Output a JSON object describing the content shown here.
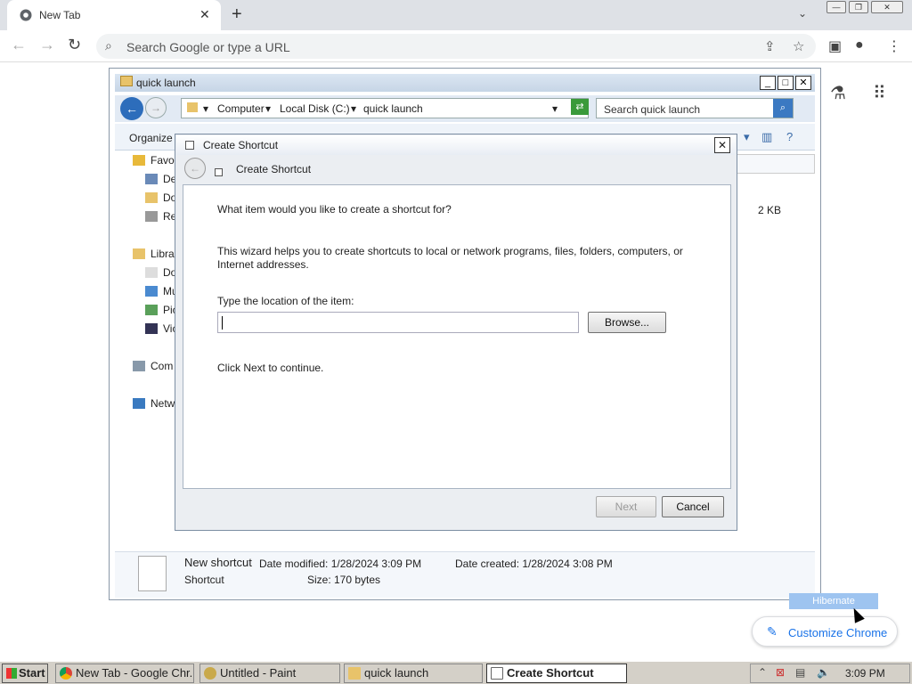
{
  "browser": {
    "tab_title": "New Tab",
    "omnibox_placeholder": "Search Google or type a URL"
  },
  "explorer": {
    "title": "quick launch",
    "breadcrumb": [
      "Computer",
      "Local Disk (C:)",
      "quick launch"
    ],
    "search_placeholder": "Search quick launch",
    "organize_label": "Organize",
    "nav": [
      {
        "label": "Favo"
      },
      {
        "label": "De"
      },
      {
        "label": "Do"
      },
      {
        "label": "Rec"
      },
      {
        "label": "Libra"
      },
      {
        "label": "Do"
      },
      {
        "label": "Mu"
      },
      {
        "label": "Pic"
      },
      {
        "label": "Vic"
      },
      {
        "label": "Com"
      },
      {
        "label": "Netw"
      }
    ],
    "size_value": "2 KB",
    "details": {
      "name": "New shortcut",
      "type": "Shortcut",
      "date_modified": "Date modified: 1/28/2024 3:09 PM",
      "date_created": "Date created: 1/28/2024 3:08 PM",
      "size": "Size: 170 bytes"
    }
  },
  "dialog": {
    "title": "Create Shortcut",
    "header": "Create Shortcut",
    "question": "What item would you like to create a shortcut for?",
    "description": "This wizard helps you to create shortcuts to local or network programs, files, folders, computers, or Internet addresses.",
    "location_label": "Type the location of the item:",
    "location_value": "",
    "browse_label": "Browse...",
    "continue_hint": "Click Next to continue.",
    "next_label": "Next",
    "cancel_label": "Cancel"
  },
  "ntp": {
    "hibernate_label": "Hibernate",
    "customize_label": "Customize Chrome"
  },
  "taskbar": {
    "start_label": "Start",
    "tasks": [
      {
        "label": "New Tab - Google Chr..."
      },
      {
        "label": "Untitled - Paint"
      },
      {
        "label": "quick launch"
      },
      {
        "label": "Create Shortcut"
      }
    ],
    "clock": "3:09 PM"
  }
}
